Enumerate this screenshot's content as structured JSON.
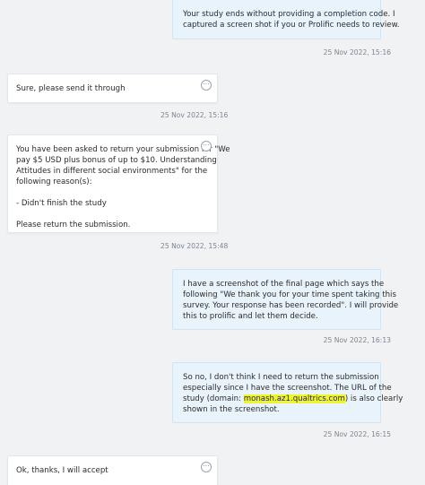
{
  "messages": [
    {
      "lines": [
        "Your study ends without providing a completion code. I",
        "captured a screen shot if you or Prolific needs to review."
      ],
      "timestamp": "25 Nov 2022, 15:16"
    },
    {
      "lines": [
        "Sure, please send it through"
      ],
      "timestamp": "25 Nov 2022, 15:16",
      "more_icon": "ellipsis-icon"
    },
    {
      "lines": [
        "You have been asked to return your submission for \"We",
        "pay $5 USD plus bonus of up to $10. Understanding",
        "Attitudes in different social environments\" for the",
        "following reason(s):",
        "",
        "- Didn't finish the study",
        "",
        "Please return the submission."
      ],
      "timestamp": "25 Nov 2022, 15:48",
      "more_icon": "ellipsis-icon"
    },
    {
      "lines": [
        "I have a screenshot of the final page which says the",
        "following \"We thank you for your time spent taking this",
        "survey. Your response has been recorded\". I will provide",
        "this to prolific and let them decide."
      ],
      "timestamp": "25 Nov 2022, 16:13"
    },
    {
      "lines": [
        "So no, I don't think I need to return the submission",
        "especially since I have the screenshot. The URL of the"
      ],
      "line3_prefix": "study (domain: ",
      "line3_highlight": "monash.az1.qualtrics.com",
      "line3_suffix": ") is also clearly",
      "line4": "shown in the screenshot.",
      "timestamp": "25 Nov 2022, 16:15",
      "highlight_color": "#eef52a"
    },
    {
      "lines": [
        "Ok, thanks, I will accept"
      ],
      "more_icon": "ellipsis-icon"
    }
  ]
}
